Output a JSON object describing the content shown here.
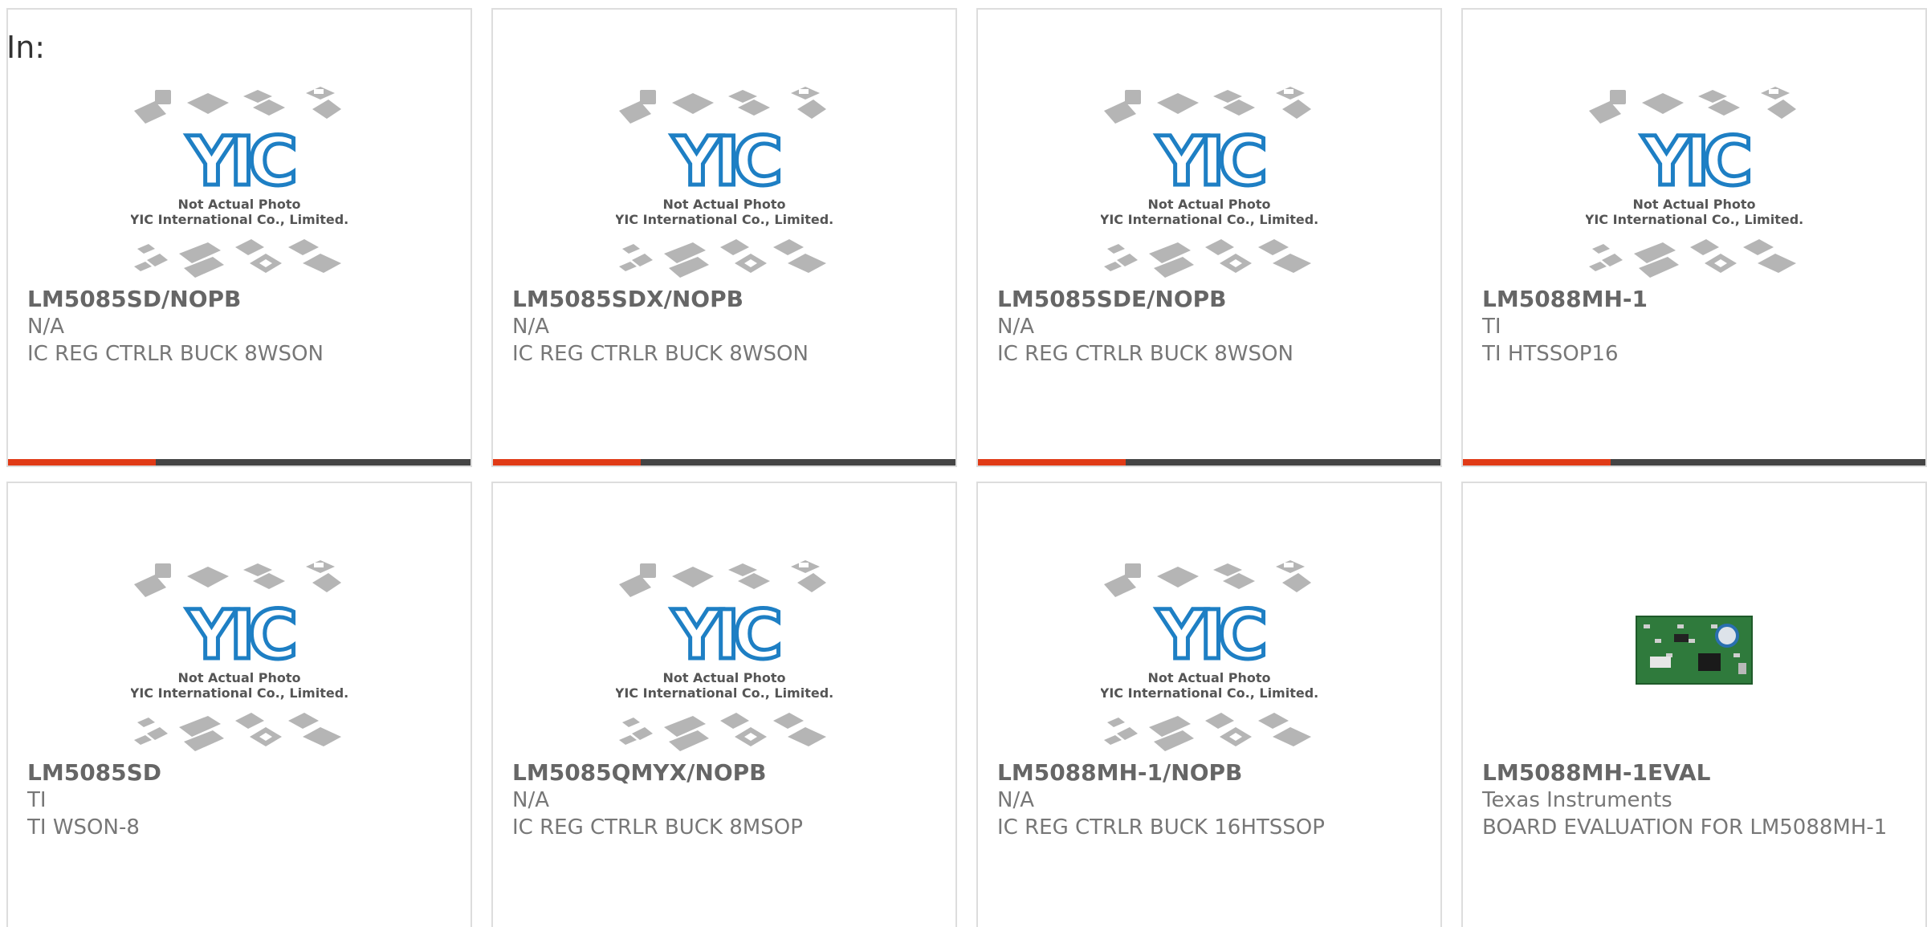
{
  "header": {
    "label": "In:"
  },
  "theme": {
    "accent": "#e03a16",
    "bar": "#444444",
    "logo_blue": "#1e7fc4",
    "chip_gray": "#b5b5b5"
  },
  "placeholder": {
    "logo_text": "YIC",
    "line1": "Not Actual Photo",
    "line2": "YIC International Co., Limited."
  },
  "products": [
    {
      "part": "LM5085SD/NOPB",
      "mfr": "N/A",
      "desc": "IC REG CTRLR BUCK 8WSON",
      "image": "placeholder",
      "accent_fraction": 0.32
    },
    {
      "part": "LM5085SDX/NOPB",
      "mfr": "N/A",
      "desc": "IC REG CTRLR BUCK 8WSON",
      "image": "placeholder",
      "accent_fraction": 0.32
    },
    {
      "part": "LM5085SDE/NOPB",
      "mfr": "N/A",
      "desc": "IC REG CTRLR BUCK 8WSON",
      "image": "placeholder",
      "accent_fraction": 0.32
    },
    {
      "part": "LM5088MH-1",
      "mfr": "TI",
      "desc": "TI HTSSOP16",
      "image": "placeholder",
      "accent_fraction": 0.32
    },
    {
      "part": "LM5085SD",
      "mfr": "TI",
      "desc": "TI WSON-8",
      "image": "placeholder",
      "accent_fraction": 0
    },
    {
      "part": "LM5085QMYX/NOPB",
      "mfr": "N/A",
      "desc": "IC REG CTRLR BUCK 8MSOP",
      "image": "placeholder",
      "accent_fraction": 0
    },
    {
      "part": "LM5088MH-1/NOPB",
      "mfr": "N/A",
      "desc": "IC REG CTRLR BUCK 16HTSSOP",
      "image": "placeholder",
      "accent_fraction": 0
    },
    {
      "part": "LM5088MH-1EVAL",
      "mfr": "Texas Instruments",
      "desc": "BOARD EVALUATION FOR LM5088MH-1",
      "image": "board-photo",
      "accent_fraction": 0
    }
  ]
}
